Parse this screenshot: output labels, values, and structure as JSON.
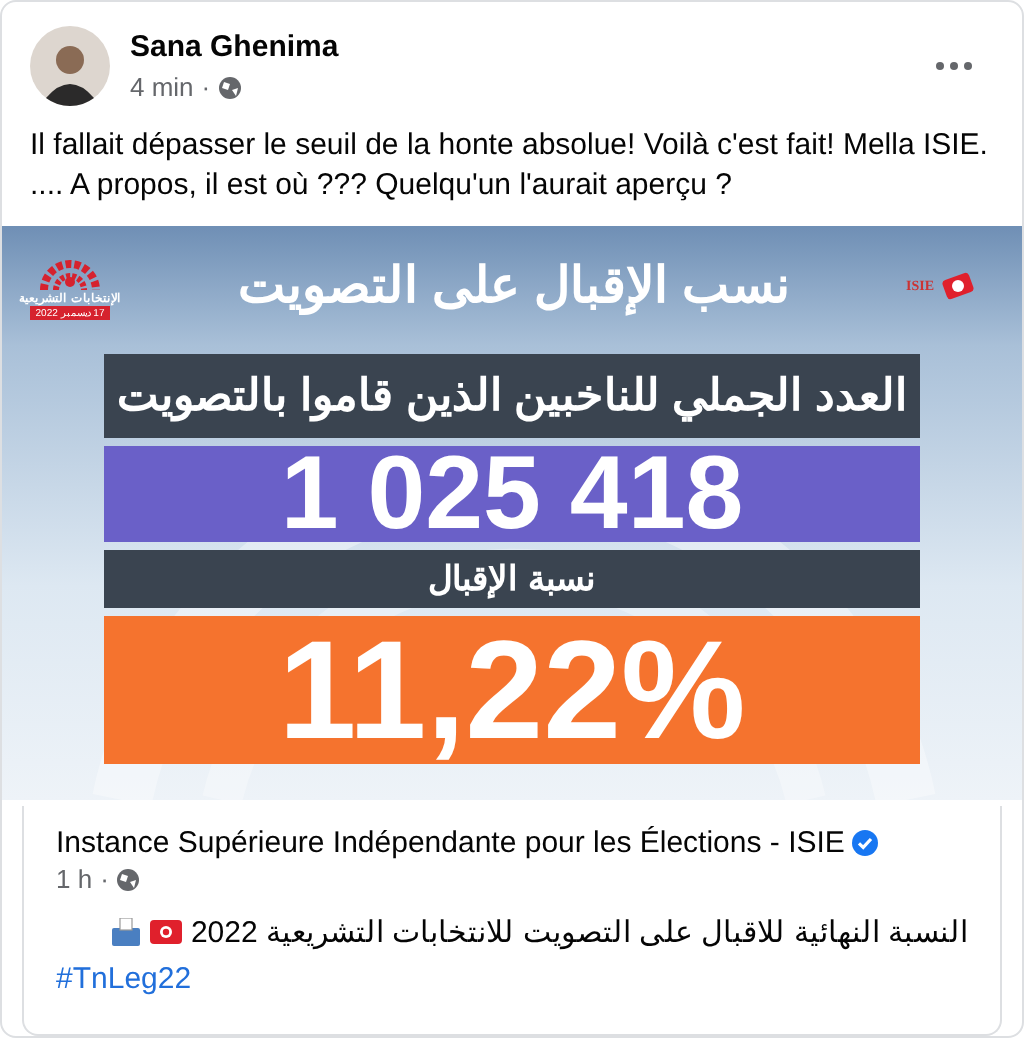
{
  "post": {
    "author": "Sana Ghenima",
    "time": "4 min",
    "separator": "·",
    "text_lines": [
      "Il fallait dépasser le seuil de la honte absolue! Voilà c'est fait! Mella ISIE.",
      ".... A propos, il est où ??? Quelqu'un l'aurait aperçu ?"
    ]
  },
  "infographic": {
    "title": "نسب الإقبال على التصويت",
    "logo_left": {
      "caption": "الإنتخابات التشريعية",
      "date": "17 ديسمبر 2022"
    },
    "logo_right": {
      "caption": "ISIE"
    },
    "bars": [
      {
        "kind": "label",
        "text": "العدد الجملي للناخبين الذين قاموا بالتصويت"
      },
      {
        "kind": "number",
        "text": "1 025 418",
        "color": "#6a60c8"
      },
      {
        "kind": "label",
        "text": "نسبة الإقبال"
      },
      {
        "kind": "number",
        "text": "11,22%",
        "color": "#f5732e"
      }
    ]
  },
  "shared_post": {
    "page_name": "Instance Supérieure Indépendante pour les Élections - ISIE",
    "verified": true,
    "time": "1 h",
    "separator": "·",
    "text": "النسبة النهائية للاقبال على التصويت للانتخابات التشريعية 2022",
    "hashtag": "#TnLeg22"
  }
}
